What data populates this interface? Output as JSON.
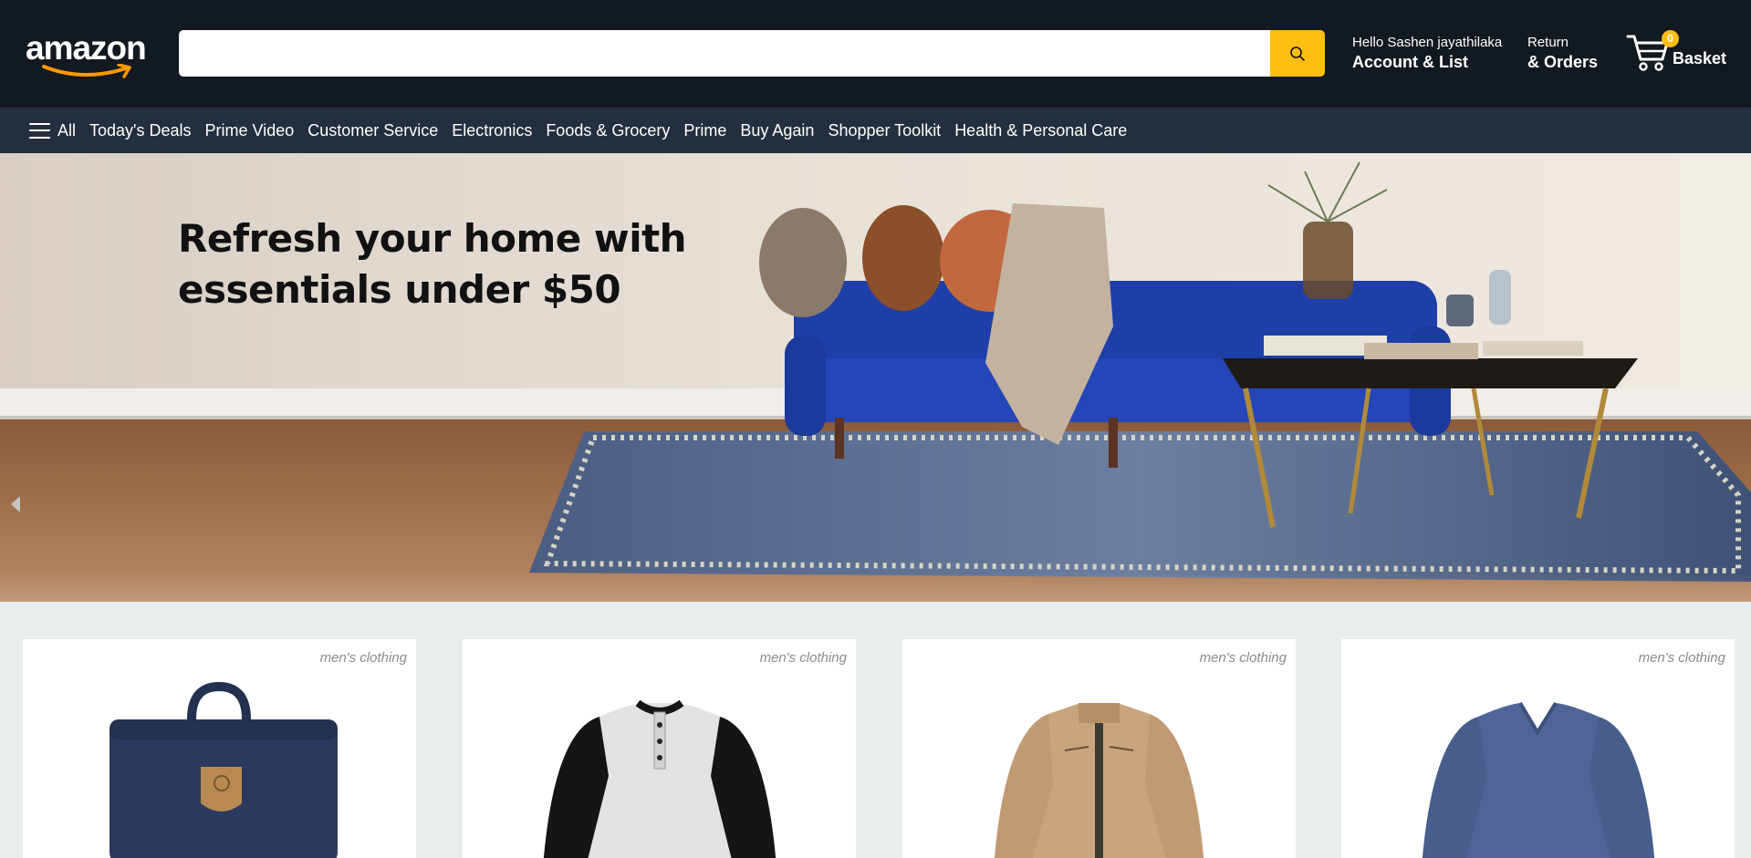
{
  "header": {
    "logo_text": "amazon",
    "search": {
      "value": "",
      "placeholder": ""
    },
    "account": {
      "greeting": "Hello Sashen jayathilaka",
      "label": "Account & List"
    },
    "orders": {
      "line1": "Return",
      "line2": "& Orders"
    },
    "basket": {
      "count": "0",
      "label": "Basket"
    }
  },
  "nav": {
    "all_label": "All",
    "items": [
      "Today's Deals",
      "Prime Video",
      "Customer Service",
      "Electronics",
      "Foods & Grocery",
      "Prime",
      "Buy Again",
      "Shopper Toolkit",
      "Health & Personal Care"
    ]
  },
  "banner": {
    "headline_line1": "Refresh your home with",
    "headline_line2": "essentials under $50"
  },
  "products": [
    {
      "category": "men's clothing",
      "image": "navy-backpack"
    },
    {
      "category": "men's clothing",
      "image": "raglan-henley-shirt"
    },
    {
      "category": "men's clothing",
      "image": "khaki-jacket"
    },
    {
      "category": "men's clothing",
      "image": "blue-vneck-shirt"
    }
  ],
  "colors": {
    "header_bg": "#131921",
    "nav_bg": "#232f3e",
    "accent": "#febd13",
    "page_bg": "#eaeded"
  }
}
